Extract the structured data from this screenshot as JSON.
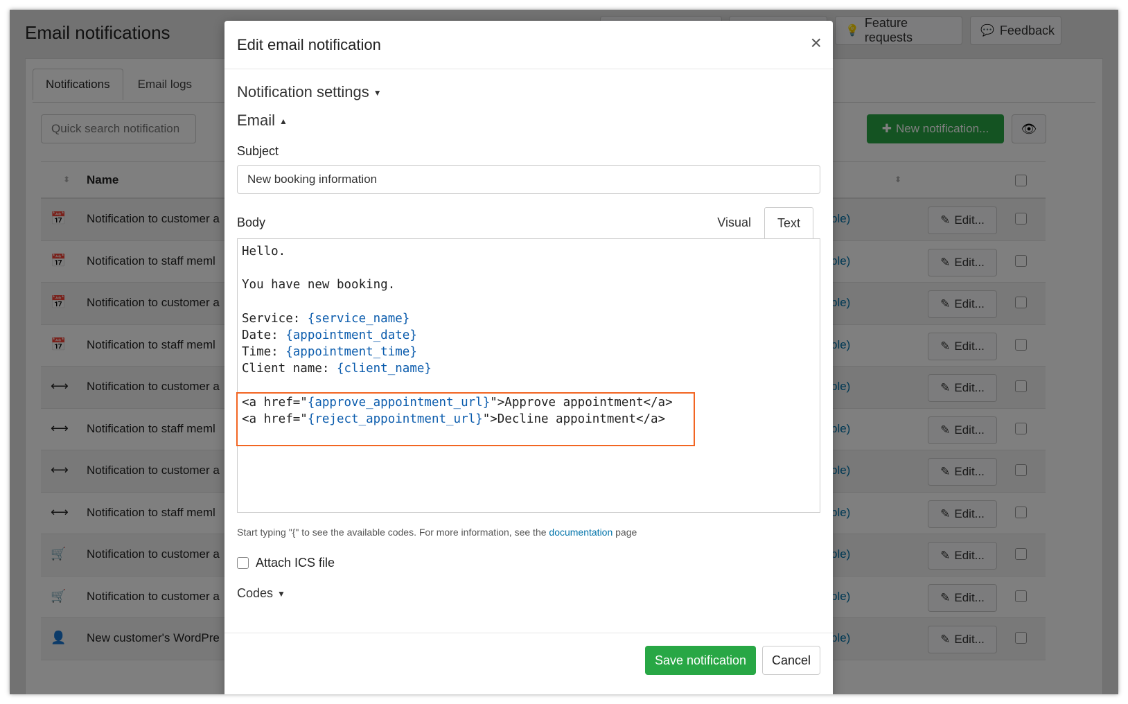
{
  "page": {
    "title": "Email notifications",
    "top_buttons": [
      {
        "icon": "lightbulb-icon",
        "glyph": "💡",
        "label": "Feature requests"
      },
      {
        "icon": "speech-bubble-icon",
        "glyph": "💬",
        "label": "Feedback"
      }
    ],
    "tabs": [
      "Notifications",
      "Email logs"
    ],
    "quick_search_placeholder": "Quick search notification",
    "new_notification_label": "New notification...",
    "table": {
      "header_name": "Name",
      "rows": [
        {
          "icon": "calendar-check-icon",
          "glyph": "📅",
          "name": "Notification to customer a",
          "link": "ble)",
          "edit": "Edit..."
        },
        {
          "icon": "calendar-check-icon",
          "glyph": "📅",
          "name": "Notification to staff meml",
          "link": "ble)",
          "edit": "Edit..."
        },
        {
          "icon": "calendar-check-icon",
          "glyph": "📅",
          "name": "Notification to customer a",
          "link": "ble)",
          "edit": "Edit..."
        },
        {
          "icon": "calendar-check-icon",
          "glyph": "📅",
          "name": "Notification to staff meml",
          "link": "ble)",
          "edit": "Edit..."
        },
        {
          "icon": "arrows-horizontal-icon",
          "glyph": "⟷",
          "name": "Notification to customer a",
          "link": "ble)",
          "edit": "Edit..."
        },
        {
          "icon": "arrows-horizontal-icon",
          "glyph": "⟷",
          "name": "Notification to staff meml",
          "link": "ble)",
          "edit": "Edit..."
        },
        {
          "icon": "arrows-horizontal-icon",
          "glyph": "⟷",
          "name": "Notification to customer a",
          "link": "ble)",
          "edit": "Edit..."
        },
        {
          "icon": "arrows-horizontal-icon",
          "glyph": "⟷",
          "name": "Notification to staff meml",
          "link": "ble)",
          "edit": "Edit..."
        },
        {
          "icon": "cart-icon",
          "glyph": "🛒",
          "name": "Notification to customer a",
          "link": "ble)",
          "edit": "Edit..."
        },
        {
          "icon": "cart-icon",
          "glyph": "🛒",
          "name": "Notification to customer a",
          "link": "ble)",
          "edit": "Edit..."
        },
        {
          "icon": "user-plus-icon",
          "glyph": "👤",
          "name": "New customer's WordPre",
          "link": "ble)",
          "edit": "Edit..."
        }
      ]
    }
  },
  "modal": {
    "title": "Edit email notification",
    "close_glyph": "×",
    "notification_settings": "Notification settings",
    "email_section": "Email",
    "subject_label": "Subject",
    "subject_value": "New booking information",
    "body_label": "Body",
    "body_tabs": [
      "Visual",
      "Text"
    ],
    "body_lines": [
      [
        {
          "t": "Hello."
        }
      ],
      [
        {
          "t": ""
        }
      ],
      [
        {
          "t": "You have new booking."
        }
      ],
      [
        {
          "t": ""
        }
      ],
      [
        {
          "t": "Service: "
        },
        {
          "t": "{service_name}",
          "code": true
        }
      ],
      [
        {
          "t": "Date: "
        },
        {
          "t": "{appointment_date}",
          "code": true
        }
      ],
      [
        {
          "t": "Time: "
        },
        {
          "t": "{appointment_time}",
          "code": true
        }
      ],
      [
        {
          "t": "Client name: "
        },
        {
          "t": "{client_name}",
          "code": true
        }
      ],
      [
        {
          "t": ""
        }
      ],
      [
        {
          "t": "<a href=\""
        },
        {
          "t": "{approve_appointment_url}",
          "code": true
        },
        {
          "t": "\">Approve appointment</a>"
        }
      ],
      [
        {
          "t": "<a href=\""
        },
        {
          "t": "{reject_appointment_url}",
          "code": true
        },
        {
          "t": "\">Decline appointment</a>"
        }
      ]
    ],
    "hint_before": "Start typing \"{\" to see the available codes. For more information, see the ",
    "hint_link": "documentation",
    "hint_after": " page",
    "attach_ics_label": "Attach ICS file",
    "codes_label": "Codes",
    "save_label": "Save notification",
    "cancel_label": "Cancel"
  },
  "colors": {
    "primary_green": "#28a745",
    "link_blue": "#0073aa",
    "code_blue": "#0b5cad",
    "highlight_orange": "#f26522"
  }
}
